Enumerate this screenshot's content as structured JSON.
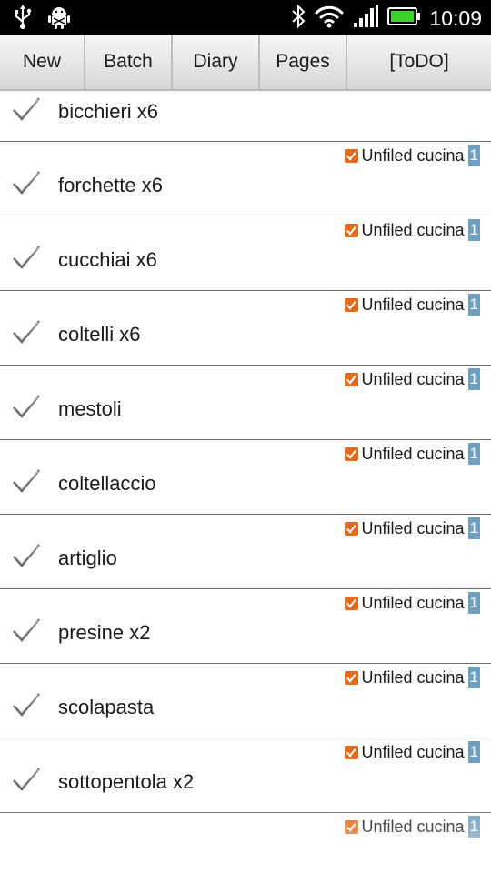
{
  "status_bar": {
    "time": "10:09",
    "icons": [
      "usb-icon",
      "android-debug-icon",
      "bluetooth-icon",
      "wifi-icon",
      "signal-icon",
      "battery-icon"
    ]
  },
  "toolbar": {
    "new_label": "New",
    "batch_label": "Batch",
    "diary_label": "Diary",
    "pages_label": "Pages",
    "todo_label": "[ToDO]"
  },
  "tag": {
    "label": "Unfiled cucina",
    "count": "1"
  },
  "items": [
    {
      "label": "bicchieri x6"
    },
    {
      "label": "forchette x6"
    },
    {
      "label": "cucchiai x6"
    },
    {
      "label": "coltelli x6"
    },
    {
      "label": "mestoli"
    },
    {
      "label": "coltellaccio"
    },
    {
      "label": "artiglio"
    },
    {
      "label": "presine x2"
    },
    {
      "label": "scolapasta"
    },
    {
      "label": "sottopentola x2"
    }
  ],
  "colors": {
    "tag_check": "#e06a1d",
    "tag_count_bg": "#6f9fbf",
    "status_bar_bg": "#000000",
    "battery": "#3bd32a"
  }
}
